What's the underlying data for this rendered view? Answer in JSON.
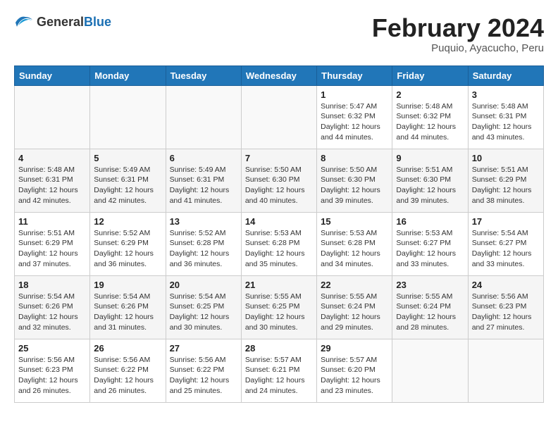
{
  "header": {
    "logo_general": "General",
    "logo_blue": "Blue",
    "month_title": "February 2024",
    "subtitle": "Puquio, Ayacucho, Peru"
  },
  "weekdays": [
    "Sunday",
    "Monday",
    "Tuesday",
    "Wednesday",
    "Thursday",
    "Friday",
    "Saturday"
  ],
  "weeks": [
    [
      {
        "day": "",
        "info": ""
      },
      {
        "day": "",
        "info": ""
      },
      {
        "day": "",
        "info": ""
      },
      {
        "day": "",
        "info": ""
      },
      {
        "day": "1",
        "info": "Sunrise: 5:47 AM\nSunset: 6:32 PM\nDaylight: 12 hours\nand 44 minutes."
      },
      {
        "day": "2",
        "info": "Sunrise: 5:48 AM\nSunset: 6:32 PM\nDaylight: 12 hours\nand 44 minutes."
      },
      {
        "day": "3",
        "info": "Sunrise: 5:48 AM\nSunset: 6:31 PM\nDaylight: 12 hours\nand 43 minutes."
      }
    ],
    [
      {
        "day": "4",
        "info": "Sunrise: 5:48 AM\nSunset: 6:31 PM\nDaylight: 12 hours\nand 42 minutes."
      },
      {
        "day": "5",
        "info": "Sunrise: 5:49 AM\nSunset: 6:31 PM\nDaylight: 12 hours\nand 42 minutes."
      },
      {
        "day": "6",
        "info": "Sunrise: 5:49 AM\nSunset: 6:31 PM\nDaylight: 12 hours\nand 41 minutes."
      },
      {
        "day": "7",
        "info": "Sunrise: 5:50 AM\nSunset: 6:30 PM\nDaylight: 12 hours\nand 40 minutes."
      },
      {
        "day": "8",
        "info": "Sunrise: 5:50 AM\nSunset: 6:30 PM\nDaylight: 12 hours\nand 39 minutes."
      },
      {
        "day": "9",
        "info": "Sunrise: 5:51 AM\nSunset: 6:30 PM\nDaylight: 12 hours\nand 39 minutes."
      },
      {
        "day": "10",
        "info": "Sunrise: 5:51 AM\nSunset: 6:29 PM\nDaylight: 12 hours\nand 38 minutes."
      }
    ],
    [
      {
        "day": "11",
        "info": "Sunrise: 5:51 AM\nSunset: 6:29 PM\nDaylight: 12 hours\nand 37 minutes."
      },
      {
        "day": "12",
        "info": "Sunrise: 5:52 AM\nSunset: 6:29 PM\nDaylight: 12 hours\nand 36 minutes."
      },
      {
        "day": "13",
        "info": "Sunrise: 5:52 AM\nSunset: 6:28 PM\nDaylight: 12 hours\nand 36 minutes."
      },
      {
        "day": "14",
        "info": "Sunrise: 5:53 AM\nSunset: 6:28 PM\nDaylight: 12 hours\nand 35 minutes."
      },
      {
        "day": "15",
        "info": "Sunrise: 5:53 AM\nSunset: 6:28 PM\nDaylight: 12 hours\nand 34 minutes."
      },
      {
        "day": "16",
        "info": "Sunrise: 5:53 AM\nSunset: 6:27 PM\nDaylight: 12 hours\nand 33 minutes."
      },
      {
        "day": "17",
        "info": "Sunrise: 5:54 AM\nSunset: 6:27 PM\nDaylight: 12 hours\nand 33 minutes."
      }
    ],
    [
      {
        "day": "18",
        "info": "Sunrise: 5:54 AM\nSunset: 6:26 PM\nDaylight: 12 hours\nand 32 minutes."
      },
      {
        "day": "19",
        "info": "Sunrise: 5:54 AM\nSunset: 6:26 PM\nDaylight: 12 hours\nand 31 minutes."
      },
      {
        "day": "20",
        "info": "Sunrise: 5:54 AM\nSunset: 6:25 PM\nDaylight: 12 hours\nand 30 minutes."
      },
      {
        "day": "21",
        "info": "Sunrise: 5:55 AM\nSunset: 6:25 PM\nDaylight: 12 hours\nand 30 minutes."
      },
      {
        "day": "22",
        "info": "Sunrise: 5:55 AM\nSunset: 6:24 PM\nDaylight: 12 hours\nand 29 minutes."
      },
      {
        "day": "23",
        "info": "Sunrise: 5:55 AM\nSunset: 6:24 PM\nDaylight: 12 hours\nand 28 minutes."
      },
      {
        "day": "24",
        "info": "Sunrise: 5:56 AM\nSunset: 6:23 PM\nDaylight: 12 hours\nand 27 minutes."
      }
    ],
    [
      {
        "day": "25",
        "info": "Sunrise: 5:56 AM\nSunset: 6:23 PM\nDaylight: 12 hours\nand 26 minutes."
      },
      {
        "day": "26",
        "info": "Sunrise: 5:56 AM\nSunset: 6:22 PM\nDaylight: 12 hours\nand 26 minutes."
      },
      {
        "day": "27",
        "info": "Sunrise: 5:56 AM\nSunset: 6:22 PM\nDaylight: 12 hours\nand 25 minutes."
      },
      {
        "day": "28",
        "info": "Sunrise: 5:57 AM\nSunset: 6:21 PM\nDaylight: 12 hours\nand 24 minutes."
      },
      {
        "day": "29",
        "info": "Sunrise: 5:57 AM\nSunset: 6:20 PM\nDaylight: 12 hours\nand 23 minutes."
      },
      {
        "day": "",
        "info": ""
      },
      {
        "day": "",
        "info": ""
      }
    ]
  ]
}
